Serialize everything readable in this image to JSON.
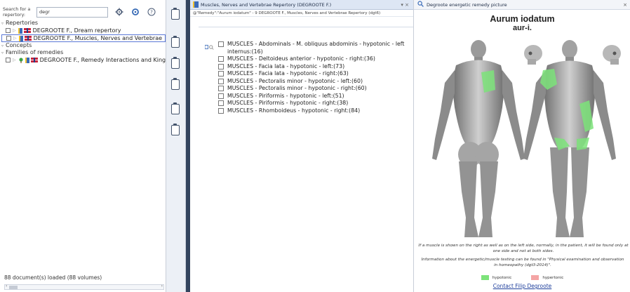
{
  "left_panel": {
    "search_label": "Search for a repertory:",
    "search_value": "degr",
    "groups": {
      "repertories": "Repertories",
      "concepts": "Concepts",
      "families": "Families of remedies"
    },
    "items": [
      "DEGROOTE F., Dream repertory",
      "DEGROOTE F., Muscles, Nerves and Vertebrae",
      "DEGROOTE F., Remedy Interactions and Kingd"
    ],
    "status": "88 document(s) loaded (88 volumes)"
  },
  "middle_panel": {
    "tab_title": "Muscles, Nerves and Vertebrae Repertory (DEGROOTE F.)",
    "tab_controls": "▾  ×",
    "query": "@\"Remedy\":\"Aurum iodatum\" - 9  DEGROOTE F., Muscles, Nerves and Vertebrae Repertory (dgt6)",
    "rubrics": [
      "MUSCLES - Abdominals - M. obliquus abdominis - hypotonic - left internus:(16)",
      "MUSCLES - Deltoideus anterior - hypotonic - right:(36)",
      "MUSCLES - Facia lata - hypotonic - left:(73)",
      "MUSCLES - Facia lata - hypotonic - right:(63)",
      "MUSCLES - Pectoralis minor - hypotonic - left:(60)",
      "MUSCLES - Pectoralis minor - hypotonic - right:(60)",
      "MUSCLES - Piriformis - hypotonic - left:(51)",
      "MUSCLES - Piriformis - hypotonic - right:(38)",
      "MUSCLES - Rhomboideus  - hypotonic - right:(84)"
    ]
  },
  "right_panel": {
    "tab_title": "Degroote energetic remedy picture",
    "close": "×",
    "remedy_name": "Aurum iodatum",
    "remedy_abbr": "aur-i.",
    "note1": "If a muscle is shown on the right as well as on the left side, normally, in the patient, it will be found only at one side and not at both sides.",
    "note2": "Information about the energetic/muscle testing can be found in \"Physical examination and observation in homeopathy (dgt3-2014)\".",
    "legend": {
      "hypotonic": "hypotonic",
      "hypertonic": "hypertonic"
    },
    "contact": "Contact Filip Degroote"
  },
  "colors": {
    "hypotonic": "#7de37a",
    "hypertonic": "#f4a5a5",
    "accent": "#3a6bb8",
    "dark_gap": "#33445e"
  },
  "icons": [
    "settings-icon",
    "refresh-icon",
    "help-icon",
    "clipboard-icon",
    "book-icon",
    "flag-icon",
    "search-icon",
    "close-icon"
  ]
}
